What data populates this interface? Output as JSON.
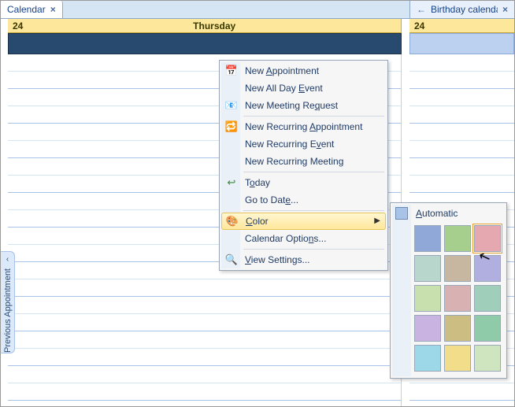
{
  "tabs": {
    "left": {
      "label": "Calendar"
    },
    "right": {
      "label": "Birthday calendar"
    }
  },
  "day": {
    "number": "24",
    "name": "Thursday"
  },
  "side_day": {
    "number": "24"
  },
  "prev_appt": {
    "chevron": "‹",
    "label": "Previous Appointment"
  },
  "menu": {
    "new_appointment": "New Appointment",
    "new_allday": "New All Day Event",
    "new_meeting": "New Meeting Request",
    "new_recurring_appt": "New Recurring Appointment",
    "new_recurring_event": "New Recurring Event",
    "new_recurring_meeting": "New Recurring Meeting",
    "today": "Today",
    "goto_date": "Go to Date...",
    "color": "Color",
    "calendar_options": "Calendar Options...",
    "view_settings": "View Settings..."
  },
  "color_submenu": {
    "automatic": "Automatic",
    "swatches": [
      "#8fa8d8",
      "#a6cf8e",
      "#e6a8b0",
      "#b8d6cc",
      "#c7b7a0",
      "#b0afe0",
      "#c7e0ae",
      "#d8b2b2",
      "#9fcfba",
      "#c9b3e0",
      "#ccbd82",
      "#8fcba8",
      "#9dd8e8",
      "#f2dd8a",
      "#cfe5c0"
    ],
    "selected_index": 2
  },
  "icons": {
    "close": "×",
    "arrow_left": "←",
    "submenu_arrow": "▶",
    "calendar": "📅",
    "meeting": "📧",
    "recurring": "🔁",
    "today_back": "↩",
    "color_wheel": "🎨",
    "view_settings": "🔍"
  }
}
